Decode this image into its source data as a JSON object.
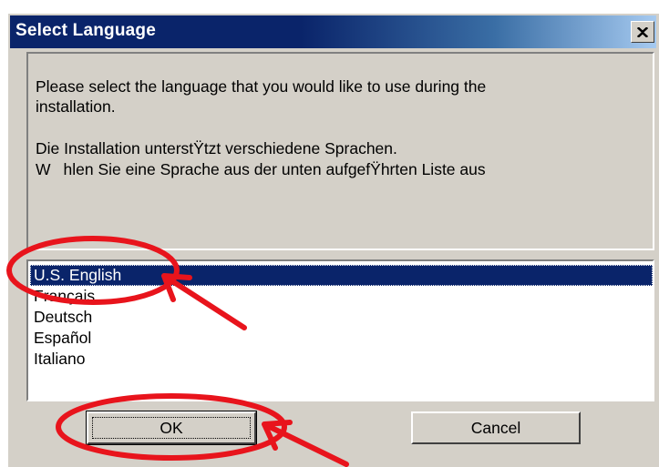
{
  "dialog": {
    "title": "Select Language"
  },
  "message": {
    "line1": "Please select the language that you would like to use during the",
    "line2": "installation.",
    "line3": "Die Installation unterstŸtzt verschiedene Sprachen.",
    "line4": "Whlen Sie eine Sprache aus der unten aufgefŸhrten Liste aus"
  },
  "languages": {
    "selected": "U.S. English",
    "items": [
      "U.S. English",
      "Français",
      "Deutsch",
      "Español",
      "Italiano"
    ]
  },
  "buttons": {
    "ok": "OK",
    "cancel": "Cancel"
  },
  "colors": {
    "annotation": "#e8141c",
    "selection": "#0a246a",
    "dialog_face": "#d4d0c8"
  },
  "icons": {
    "close": "close-x-icon"
  }
}
